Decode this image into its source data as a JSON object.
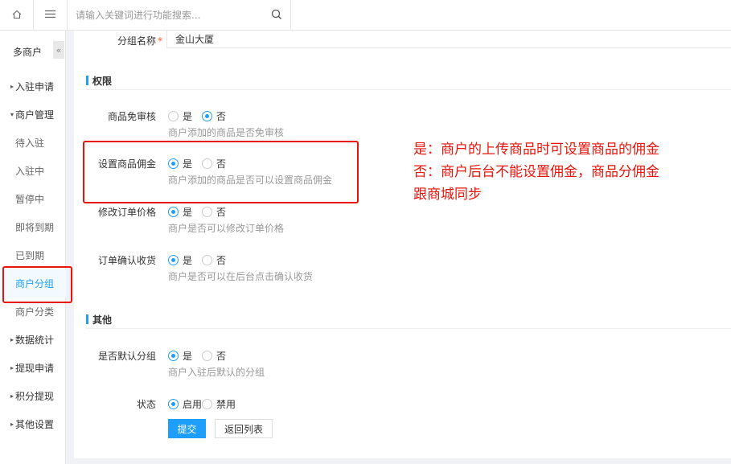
{
  "topbar": {
    "home_icon": "home-icon",
    "menu_icon": "hamburger-icon",
    "search_placeholder": "请输入关键词进行功能搜索...",
    "search_icon": "search-icon"
  },
  "sidebar": {
    "title": "多商户",
    "collapse_glyph": "«",
    "items": [
      {
        "label": "入驻申请",
        "type": "group",
        "caret": "▸"
      },
      {
        "label": "商户管理",
        "type": "group",
        "caret": "▾"
      },
      {
        "label": "待入驻",
        "type": "sub"
      },
      {
        "label": "入驻中",
        "type": "sub"
      },
      {
        "label": "暂停中",
        "type": "sub"
      },
      {
        "label": "即将到期",
        "type": "sub"
      },
      {
        "label": "已到期",
        "type": "sub"
      },
      {
        "label": "商户分组",
        "type": "sub",
        "active": true
      },
      {
        "label": "商户分类",
        "type": "sub"
      },
      {
        "label": "数据统计",
        "type": "group",
        "caret": "▸"
      },
      {
        "label": "提现申请",
        "type": "group",
        "caret": "▸"
      },
      {
        "label": "积分提现",
        "type": "group",
        "caret": "▸"
      },
      {
        "label": "其他设置",
        "type": "group",
        "caret": "▸"
      }
    ]
  },
  "form": {
    "group_name_label": "分组名称",
    "required_mark": "*",
    "group_name_value": "金山大厦",
    "section_permission": "权限",
    "section_other": "其他",
    "fields": {
      "goods_review": {
        "label": "商品免审核",
        "yes": "是",
        "no": "否",
        "selected": "否",
        "hint": "商户添加的商品是否免审核"
      },
      "commission": {
        "label": "设置商品佣金",
        "yes": "是",
        "no": "否",
        "selected": "是",
        "hint": "商户添加的商品是否可以设置商品佣金"
      },
      "order_price": {
        "label": "修改订单价格",
        "yes": "是",
        "no": "否",
        "selected": "是",
        "hint": "商户是否可以修改订单价格"
      },
      "confirm_receipt": {
        "label": "订单确认收货",
        "yes": "是",
        "no": "否",
        "selected": "是",
        "hint": "商户是否可以在后台点击确认收货"
      },
      "default_group": {
        "label": "是否默认分组",
        "yes": "是",
        "no": "否",
        "selected": "是",
        "hint": "商户入驻后默认的分组"
      },
      "status": {
        "label": "状态",
        "yes": "启用",
        "no": "禁用",
        "selected": "启用"
      }
    },
    "submit_label": "提交",
    "back_label": "返回列表"
  },
  "annotation": {
    "line1": "是：商户的上传商品时可设置商品的佣金",
    "line2": "否：商户后台不能设置佣金，商品分佣金",
    "line3": "跟商城同步",
    "color": "#e8150c"
  },
  "colors": {
    "accent": "#1E9FFF"
  }
}
